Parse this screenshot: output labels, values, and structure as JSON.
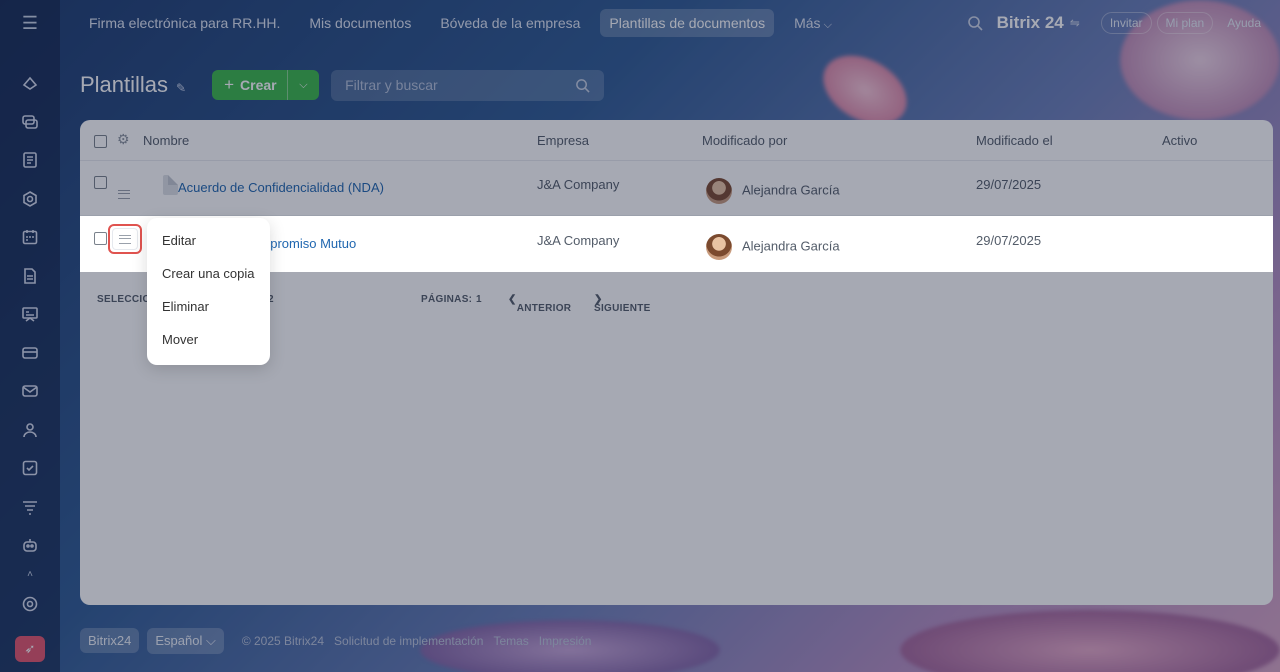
{
  "topnav": {
    "tabs": [
      "Firma electrónica para RR.HH.",
      "Mis documentos",
      "Bóveda de la empresa",
      "Plantillas de documentos",
      "Más"
    ],
    "active_index": 3,
    "brand": "Bitrix 24",
    "invite": "Invitar",
    "plan": "Mi plan",
    "help": "Ayuda"
  },
  "page": {
    "title": "Plantillas",
    "create_label": "Crear",
    "filter_placeholder": "Filtrar y buscar"
  },
  "grid": {
    "headers": {
      "name": "Nombre",
      "company": "Empresa",
      "modified_by": "Modificado por",
      "modified_on": "Modificado el",
      "active": "Activo"
    },
    "rows": [
      {
        "name": "Acuerdo de Confidencialidad (NDA)",
        "company": "J&A Company",
        "modified_by": "Alejandra García",
        "modified_on": "29/07/2025",
        "active": false
      },
      {
        "name": "npromiso Mutuo",
        "company": "J&A Company",
        "modified_by": "Alejandra García",
        "modified_on": "29/07/2025",
        "active": true
      }
    ],
    "footer": {
      "selected": "SELECCIC",
      "total": "2",
      "pages_label": "PÁGINAS:",
      "page": "1",
      "prev": "ANTERIOR",
      "next": "SIGUIENTE"
    }
  },
  "menu": {
    "items": [
      "Editar",
      "Crear una copia",
      "Eliminar",
      "Mover"
    ]
  },
  "footer": {
    "brand": "Bitrix24",
    "language": "Español",
    "copyright": "© 2025 Bitrix24",
    "implementation": "Solicitud de implementación",
    "themes": "Temas",
    "print": "Impresión"
  },
  "colors": {
    "accent_green": "#3bb849",
    "toggle_on": "#bdf036",
    "link": "#2067b0",
    "highlight_border": "#e0534f"
  }
}
